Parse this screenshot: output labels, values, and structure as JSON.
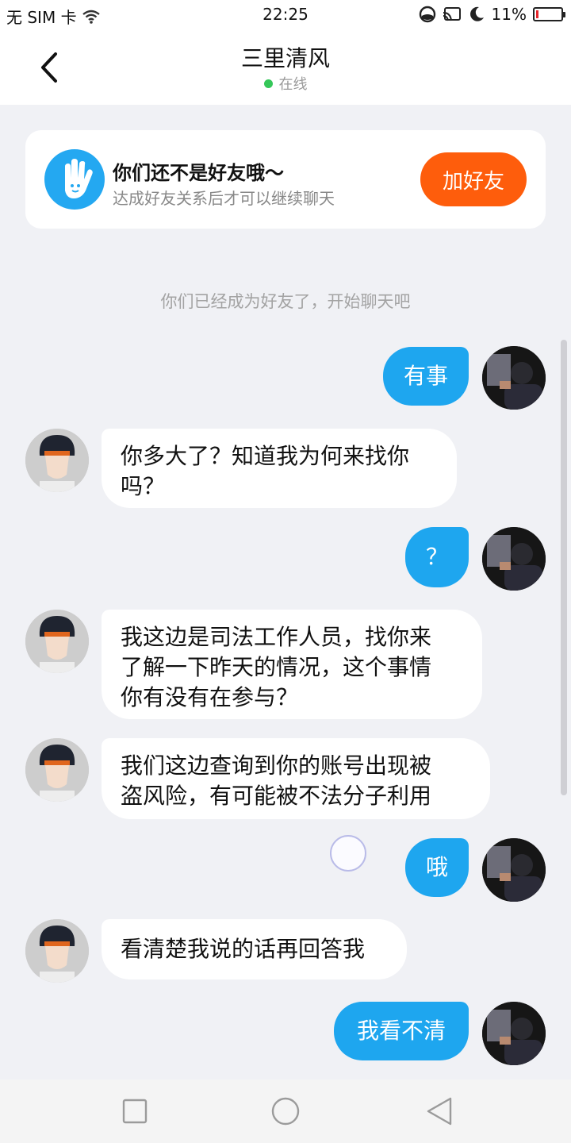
{
  "status_bar": {
    "carrier": "无 SIM 卡",
    "time": "22:25",
    "battery_percent_text": "11%",
    "battery_level": 0.11,
    "icons": [
      "wifi-icon",
      "data-saver-icon",
      "cast-icon",
      "moon-icon",
      "battery-icon"
    ]
  },
  "header": {
    "title": "三里清风",
    "presence": "在线",
    "presence_color": "#35c759"
  },
  "friend_card": {
    "title": "你们还不是好友哦～",
    "subtitle": "达成好友关系后才可以继续聊天",
    "add_button": "加好友",
    "button_color": "#fe5d0c",
    "icon_color": "#24a8f1"
  },
  "system_note": "你们已经成为好友了，开始聊天吧",
  "messages": [
    {
      "from": "me",
      "lines": [
        "有事"
      ]
    },
    {
      "from": "them",
      "lines": [
        "你多大了？知道我为何来找你",
        "吗？"
      ]
    },
    {
      "from": "me",
      "lines": [
        "？"
      ]
    },
    {
      "from": "them",
      "lines": [
        "我这边是司法工作人员，找你来",
        "了解一下昨天的情况，这个事情",
        "你有没有在参与？"
      ]
    },
    {
      "from": "them",
      "lines": [
        "我们这边查询到你的账号出现被",
        "盗风险，有可能被不法分子利用"
      ]
    },
    {
      "from": "me",
      "lines": [
        "哦"
      ]
    },
    {
      "from": "them",
      "lines": [
        "看清楚我说的话再回答我"
      ]
    },
    {
      "from": "me",
      "lines": [
        "我看不清"
      ]
    }
  ],
  "colors": {
    "my_bubble": "#1ea6ef",
    "their_bubble": "#ffffff",
    "background": "#f0f1f5"
  },
  "navbar": {
    "icons": [
      "recents-square-icon",
      "home-circle-icon",
      "back-triangle-icon"
    ]
  }
}
